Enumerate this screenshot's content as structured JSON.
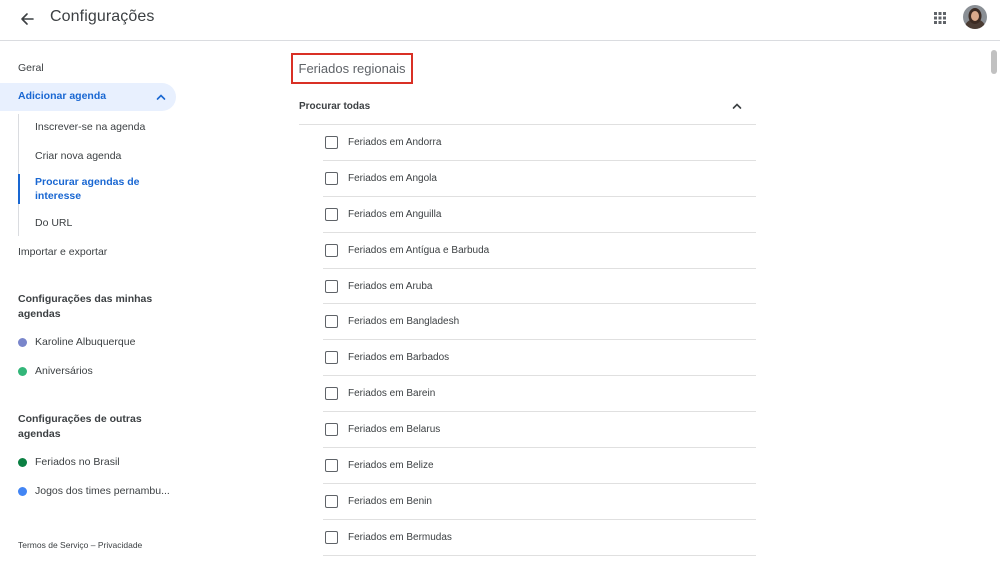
{
  "header": {
    "title": "Configurações",
    "back_icon": "arrow-left-icon",
    "apps_icon": "apps-grid-icon"
  },
  "sidebar": {
    "general": "Geral",
    "add_calendar": "Adicionar agenda",
    "add_calendar_children": [
      "Inscrever-se na agenda",
      "Criar nova agenda",
      "Procurar agendas de interesse",
      "Do URL"
    ],
    "selected_child_index": 2,
    "import_export": "Importar e exportar",
    "my_calendars_heading": "Configurações das minhas agendas",
    "my_calendars": [
      {
        "name": "Karoline Albuquerque",
        "color": "#7986cb"
      },
      {
        "name": "Aniversários",
        "color": "#33b679"
      }
    ],
    "other_calendars_heading": "Configurações de outras agendas",
    "other_calendars": [
      {
        "name": "Feriados no Brasil",
        "color": "#0b8043"
      },
      {
        "name": "Jogos dos times pernambu...",
        "color": "#4285f4"
      }
    ],
    "footer": {
      "terms": "Termos de Serviço",
      "separator": "–",
      "privacy": "Privacidade"
    }
  },
  "main": {
    "section_title": "Feriados regionais",
    "browse_all": "Procurar todas",
    "holidays": [
      "Feriados em Andorra",
      "Feriados em Angola",
      "Feriados em Anguilla",
      "Feriados em Antígua e Barbuda",
      "Feriados em Aruba",
      "Feriados em Bangladesh",
      "Feriados em Barbados",
      "Feriados em Barein",
      "Feriados em Belarus",
      "Feriados em Belize",
      "Feriados em Benin",
      "Feriados em Bermudas"
    ]
  },
  "colors": {
    "accent": "#1967d2",
    "active_bg": "#e8f0fe",
    "highlight_box": "#d93025"
  }
}
